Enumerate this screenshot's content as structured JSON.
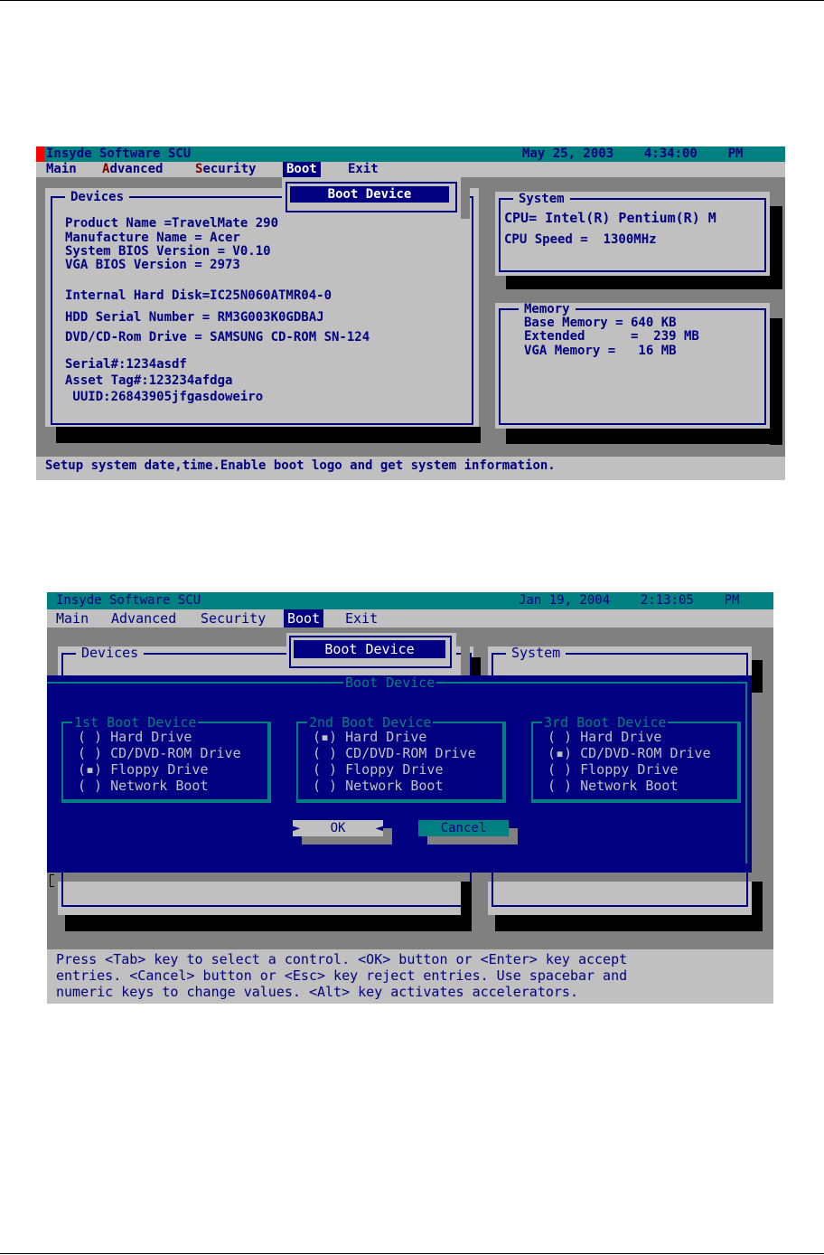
{
  "screen1": {
    "title": "Insyde Software SCU",
    "datetime": "May 25, 2003    4:34:00    PM",
    "menu": [
      {
        "label": "Main",
        "hotkey": "",
        "rest": "Main"
      },
      {
        "label": "Advanced",
        "hotkey": "A",
        "rest": "dvanced"
      },
      {
        "label": "Security",
        "hotkey": "S",
        "rest": "ecurity"
      },
      {
        "label": "Boot",
        "hotkey": "",
        "rest": "Boot",
        "selected": true
      },
      {
        "label": "Exit",
        "hotkey": "",
        "rest": "Exit"
      }
    ],
    "boot_submenu_item": "Boot Device",
    "devices": {
      "title": "Devices",
      "rows": [
        "Product Name =TravelMate 290",
        "Manufacture Name = Acer",
        "System BIOS Version = V0.10",
        "VGA BIOS Version = 2973",
        "Internal Hard Disk=IC25N060ATMR04-0",
        "HDD Serial Number = RM3G003K0GDBAJ",
        "DVD/CD-Rom Drive = SAMSUNG CD-ROM SN-124",
        "Serial#:1234asdf",
        "Asset Tag#:123234afdga",
        " UUID:26843905jfgasdoweiro"
      ]
    },
    "system": {
      "title": "System",
      "rows": [
        "CPU= Intel(R) Pentium(R) M",
        "CPU Speed =  1300MHz"
      ]
    },
    "memory": {
      "title": "Memory",
      "rows": [
        "Base Memory = 640 KB",
        "Extended      =  239 MB",
        "VGA Memory =   16 MB"
      ]
    },
    "status": "Setup system date,time.Enable boot logo and get system information."
  },
  "screen2": {
    "title": "Insyde Software SCU",
    "datetime": "Jan 19, 2004    2:13:05    PM",
    "menu": [
      {
        "label": "Main"
      },
      {
        "label": "Advanced"
      },
      {
        "label": "Security"
      },
      {
        "label": "Boot",
        "selected": true
      },
      {
        "label": "Exit"
      }
    ],
    "boot_submenu_item": "Boot Device",
    "devices_title": "Devices",
    "system_title": "System",
    "dialog": {
      "title": "Boot Device",
      "groups": [
        {
          "title": "1st Boot Device",
          "options": [
            {
              "label": "Hard Drive",
              "mark": "( )"
            },
            {
              "label": "CD/DVD-ROM Drive",
              "mark": "( )"
            },
            {
              "label": "Floppy Drive",
              "mark": "(▪)",
              "selected": true
            },
            {
              "label": "Network Boot",
              "mark": "( )"
            }
          ]
        },
        {
          "title": "2nd Boot Device",
          "options": [
            {
              "label": "Hard Drive",
              "mark": "(▪)",
              "selected": true
            },
            {
              "label": "CD/DVD-ROM Drive",
              "mark": "( )"
            },
            {
              "label": "Floppy Drive",
              "mark": "( )"
            },
            {
              "label": "Network Boot",
              "mark": "( )"
            }
          ]
        },
        {
          "title": "3rd Boot Device",
          "options": [
            {
              "label": "Hard Drive",
              "mark": "( )"
            },
            {
              "label": "CD/DVD-ROM Drive",
              "mark": "(▪)",
              "selected": true
            },
            {
              "label": "Floppy Drive",
              "mark": "( )"
            },
            {
              "label": "Network Boot",
              "mark": "( )"
            }
          ]
        }
      ],
      "ok_label": "OK",
      "cancel_label": "Cancel"
    },
    "status_lines": [
      "Press <Tab> key to select a control. <OK> button or <Enter> key accept",
      "entries. <Cancel> button or <Esc> key reject entries. Use spacebar and",
      "numeric keys to change values. <Alt> key activates accelerators."
    ]
  },
  "colors": {
    "bios_blue": "#000080",
    "bios_teal": "#008080",
    "bios_gray": "#c0c0c0",
    "bios_dark_gray": "#808080",
    "hotkey_red": "#800000"
  }
}
